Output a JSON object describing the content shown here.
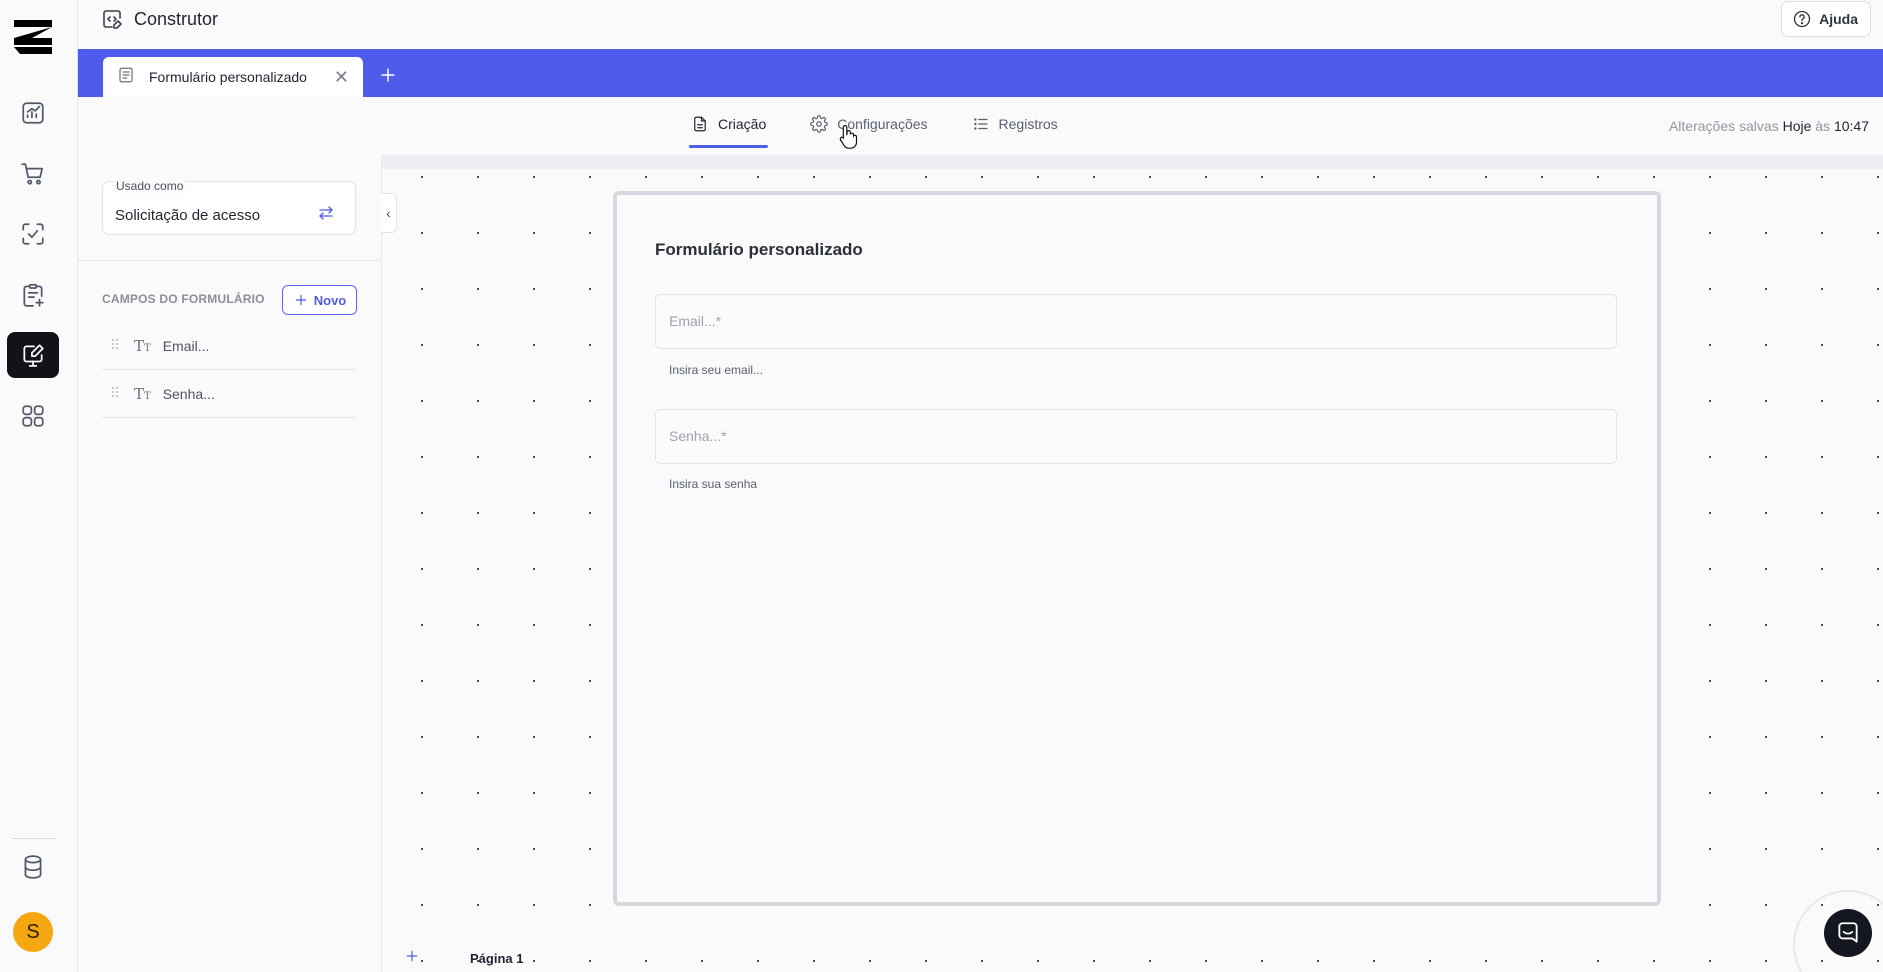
{
  "app": {
    "title": "Construtor",
    "help_label": "Ajuda"
  },
  "rail": {
    "items": [
      {
        "icon": "dashboard-chart-icon"
      },
      {
        "icon": "cart-icon"
      },
      {
        "icon": "scan-check-icon"
      },
      {
        "icon": "clipboard-add-icon"
      },
      {
        "icon": "form-builder-icon",
        "active": true
      },
      {
        "icon": "apps-grid-icon"
      }
    ],
    "bottom_icon": "database-icon",
    "avatar_initial": "S"
  },
  "tabs": {
    "open": [
      {
        "label": "Formulário personalizado"
      }
    ]
  },
  "views": {
    "items": [
      {
        "label": "Criação",
        "active": true
      },
      {
        "label": "Configurações"
      },
      {
        "label": "Registros"
      }
    ],
    "saved_prefix": "Alterações salvas",
    "saved_day": "Hoje",
    "saved_sep": "às",
    "saved_time": "10:47"
  },
  "panel": {
    "usage_label": "Usado como",
    "usage_value": "Solicitação de acesso",
    "fields_title": "CAMPOS DO FORMULÁRIO",
    "new_button": "Novo",
    "fields": [
      {
        "name": "Email..."
      },
      {
        "name": "Senha..."
      }
    ]
  },
  "form": {
    "title": "Formulário personalizado",
    "inputs": [
      {
        "placeholder": "Email...*",
        "helper": "Insira seu email..."
      },
      {
        "placeholder": "Senha...*",
        "helper": "Insira sua senha"
      }
    ]
  },
  "pager": {
    "label": "Página 1"
  },
  "colors": {
    "accent": "#4f5bea",
    "avatar": "#f5a711",
    "active_nav": "#111318"
  }
}
